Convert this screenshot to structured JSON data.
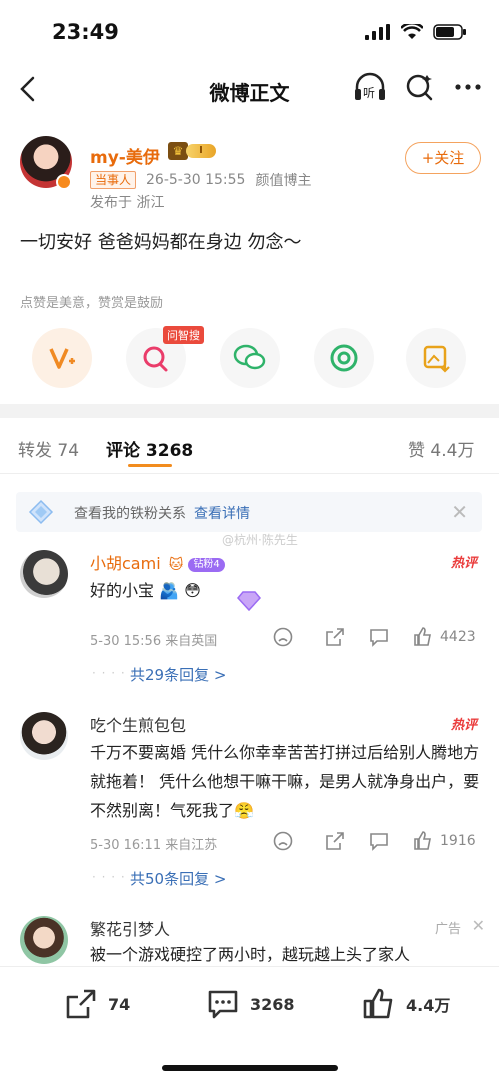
{
  "status": {
    "time": "23:49"
  },
  "nav": {
    "title": "微博正文",
    "listen_label": "听"
  },
  "author": {
    "name": "my-美伊",
    "vip_level": "I",
    "tag": "当事人",
    "date": "26-5-30 15:55",
    "identity": "颜值博主",
    "location": "发布于 浙江",
    "follow_label": "+关注"
  },
  "post": {
    "text": "一切安好 爸爸妈妈都在身边 勿念～",
    "reward_hint": "点赞是美意，赞赏是鼓励",
    "ask_tag": "问智搜"
  },
  "tabs": {
    "repost": "转发 74",
    "comments": "评论 3268",
    "likes": "赞 4.4万"
  },
  "fans_bar": {
    "text": "查看我的铁粉关系",
    "link": "查看详情"
  },
  "watermark": "@杭州·陈先生",
  "comments": [
    {
      "name": "小胡cami",
      "badge": "钻粉4",
      "hot": "热评",
      "text": "好的小宝 🫂 😳",
      "meta": "5-30 15:56 来自英国",
      "likes": "4423",
      "replies": "共29条回复 >"
    },
    {
      "name": "吃个生煎包包",
      "hot": "热评",
      "text": "千万不要离婚 凭什么你幸幸苦苦打拼过后给别人腾地方 就拖着！ 凭什么他想干嘛干嘛，是男人就净身出户，要不然别离！气死我了😤",
      "meta": "5-30 16:11 来自江苏",
      "likes": "1916",
      "replies": "共50条回复 >"
    },
    {
      "name": "繁花引梦人",
      "ad": "广告",
      "text": "被一个游戏硬控了两小时，越玩越上头了家人"
    }
  ],
  "bottom_bar": {
    "reposts": "74",
    "comments": "3268",
    "likes": "4.4万"
  },
  "colors": {
    "accent": "#e86b0c",
    "link": "#3a6fb6",
    "hot": "#ea3c3c"
  }
}
